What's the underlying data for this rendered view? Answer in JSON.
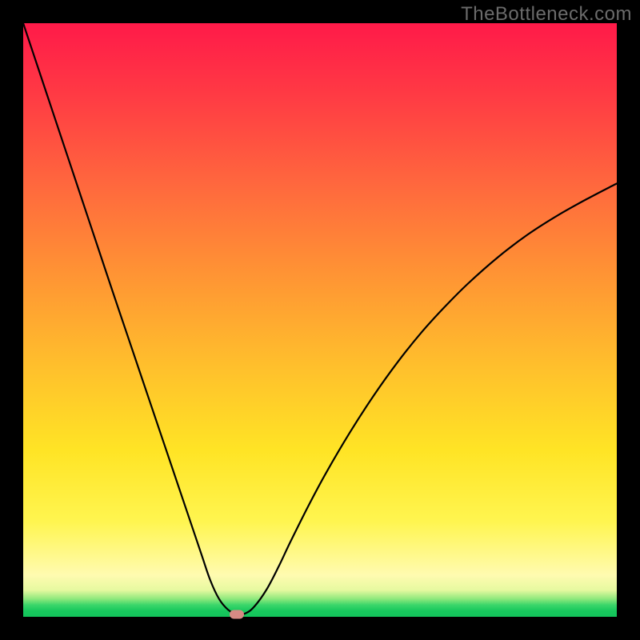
{
  "watermark": "TheBottleneck.com",
  "chart_data": {
    "type": "line",
    "title": "",
    "xlabel": "",
    "ylabel": "",
    "xlim": [
      0,
      100
    ],
    "ylim": [
      0,
      100
    ],
    "grid": false,
    "legend": false,
    "colors": {
      "top": "#ff1a49",
      "mid": "#ffe425",
      "bottom": "#13c45b",
      "curve": "#000000",
      "marker": "#d78a84"
    },
    "series": [
      {
        "name": "bottleneck-curve",
        "x": [
          0,
          2.5,
          5,
          7.5,
          10,
          12.5,
          15,
          17.5,
          20,
          22.5,
          25,
          27.5,
          30,
          31.5,
          33,
          34.5,
          36,
          37.5,
          39,
          41,
          43,
          45,
          48,
          51,
          55,
          59,
          63,
          67,
          71,
          75,
          80,
          85,
          90,
          95,
          100
        ],
        "y": [
          100,
          92.5,
          85,
          77.5,
          70,
          62.5,
          55,
          47.6,
          40.2,
          32.8,
          25.4,
          18,
          10.6,
          6.2,
          3.0,
          1.2,
          0.4,
          0.6,
          1.8,
          4.6,
          8.4,
          12.6,
          18.6,
          24.2,
          31,
          37.2,
          42.8,
          47.8,
          52.2,
          56.2,
          60.6,
          64.4,
          67.6,
          70.4,
          73
        ]
      }
    ],
    "marker": {
      "x": 36,
      "y": 0.4
    }
  }
}
